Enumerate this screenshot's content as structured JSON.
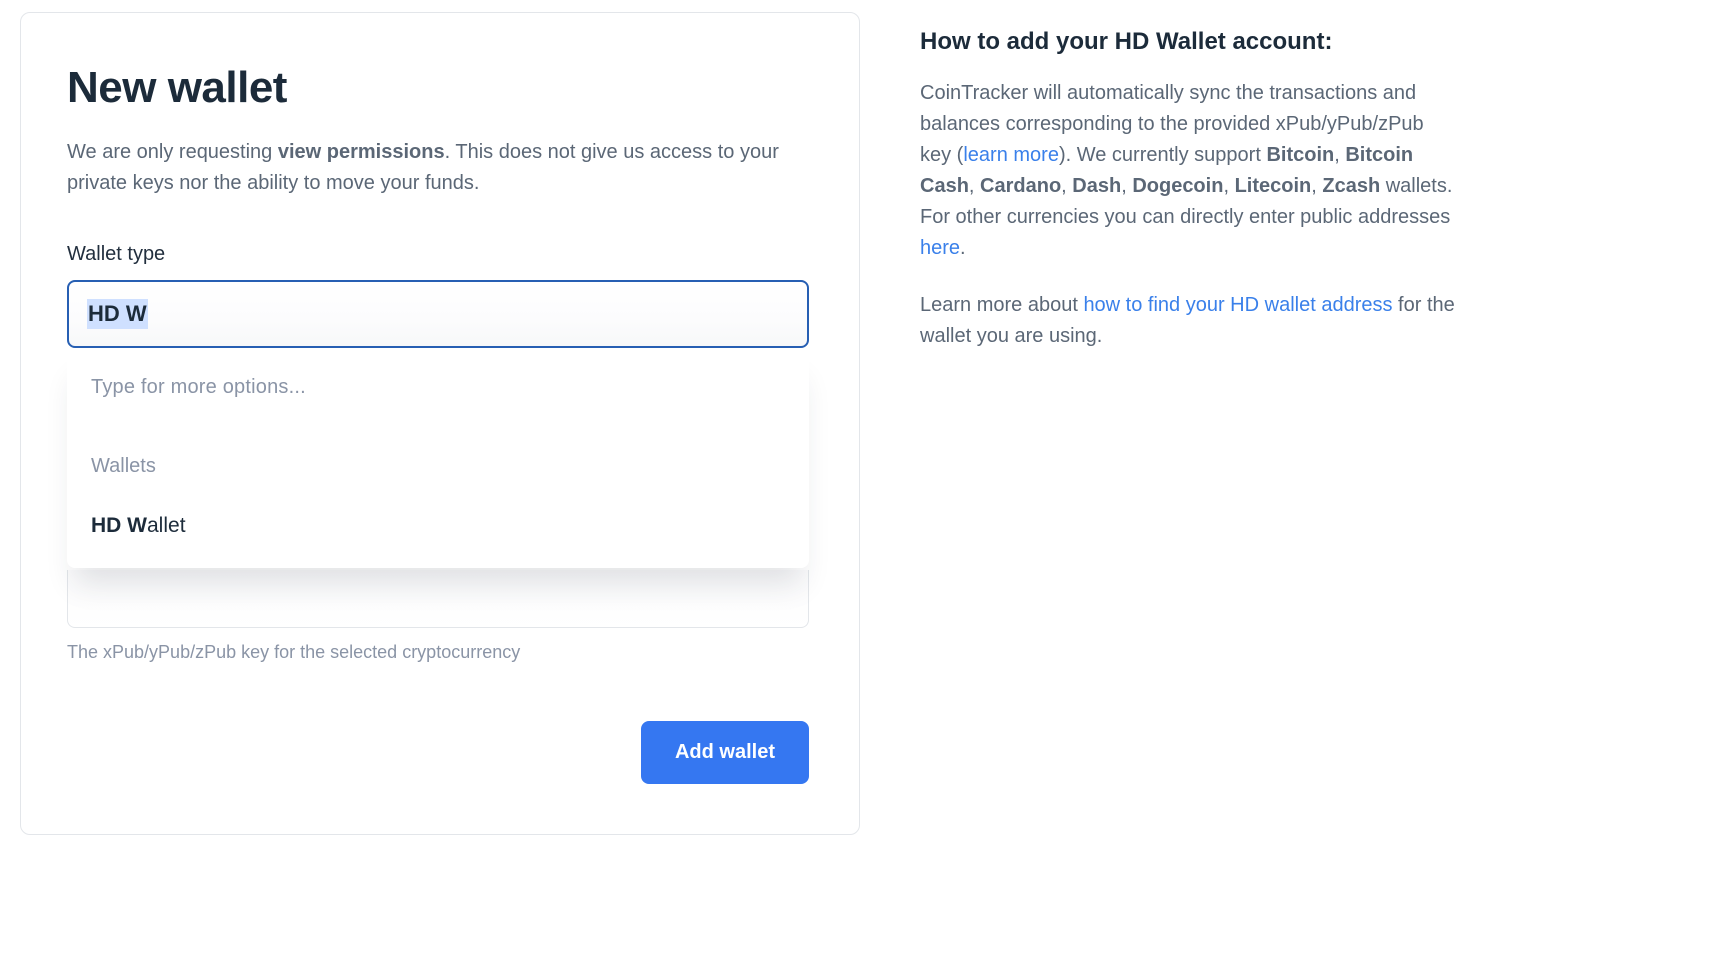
{
  "form": {
    "title": "New wallet",
    "subtitle_before": "We are only requesting ",
    "subtitle_strong": "view permissions",
    "subtitle_after": ". This does not give us access to your private keys nor the ability to move your funds.",
    "wallet_type_label": "Wallet type",
    "input_value": "HD W",
    "dropdown": {
      "hint": "Type for more options...",
      "section_label": "Wallets",
      "item_match": "HD W",
      "item_rest": "allet"
    },
    "pubkey_helper": "The xPub/yPub/zPub key for the selected cryptocurrency",
    "submit_label": "Add wallet"
  },
  "help": {
    "heading": "How to add your HD Wallet account:",
    "p1_before": "CoinTracker will automatically sync the transactions and balances corresponding to the provided xPub/yPub/zPub key (",
    "p1_link1": "learn more",
    "p1_mid1": "). We currently support ",
    "coins": [
      "Bitcoin",
      "Bitcoin Cash",
      "Cardano",
      "Dash",
      "Dogecoin",
      "Litecoin",
      "Zcash"
    ],
    "p1_mid2": " wallets. For other currencies you can directly enter public addresses ",
    "p1_link2": "here",
    "p1_after": ".",
    "p2_before": "Learn more about ",
    "p2_link": "how to find your HD wallet address",
    "p2_after": " for the wallet you are using."
  }
}
